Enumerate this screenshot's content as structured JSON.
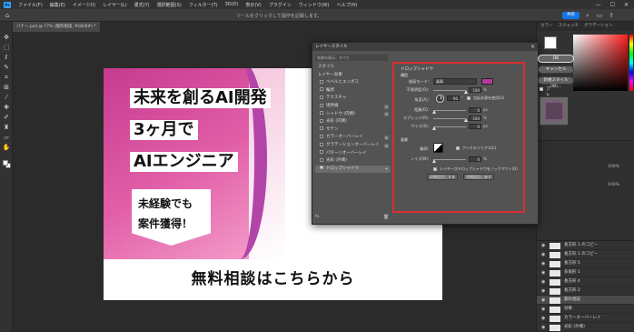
{
  "menubar": {
    "logo": "Ps",
    "items": [
      "ファイル(F)",
      "編集(E)",
      "イメージ(I)",
      "レイヤー(L)",
      "書式(Y)",
      "選択範囲(S)",
      "フィルター(T)",
      "3D(D)",
      "表示(V)",
      "プラグイン",
      "ウィンドウ(W)",
      "ヘルプ(H)"
    ],
    "window_controls": [
      "—",
      "☐",
      "✕"
    ]
  },
  "options_bar": {
    "hint": "ツールをクリックして操作を記録します。",
    "share_label": "共有"
  },
  "document_tab": {
    "label": "バナー.psd @ 77% (無料相談, RGB/8#) *"
  },
  "banner": {
    "line1": "未来を創るAI開発",
    "line2": "3ヶ月で",
    "line3": "AIエンジニア",
    "sub1": "未経験でも",
    "sub2": "案件獲得！",
    "cta": "無料相談はこちらから"
  },
  "right_panel": {
    "tabs": [
      "カラー",
      "スウォッチ",
      "グラデーション"
    ],
    "props_labels": [
      "100%",
      "100%"
    ],
    "layers": [
      {
        "name": "長方形 1 のコピー",
        "selected": false
      },
      {
        "name": "長方形 1 のコピー",
        "selected": false
      },
      {
        "name": "長方形 5",
        "selected": false
      },
      {
        "name": "多角形 1",
        "selected": false
      },
      {
        "name": "長方形 4",
        "selected": false
      },
      {
        "name": "長方形 2",
        "selected": false
      },
      {
        "name": "無料相談",
        "selected": true
      },
      {
        "name": "効果",
        "selected": false
      },
      {
        "name": "カラーオーバーレイ",
        "selected": false
      },
      {
        "name": "光彩 (外側)",
        "selected": false
      }
    ]
  },
  "dialog": {
    "title": "レイヤースタイル",
    "search_placeholder": "効果の表示：すべて",
    "styles": [
      {
        "label": "スタイル",
        "checkbox": false,
        "plus": false,
        "selected": false
      },
      {
        "label": "レイヤー効果",
        "checkbox": false,
        "plus": false,
        "selected": false
      },
      {
        "label": "ベベルとエンボス",
        "checkbox": true,
        "plus": false,
        "selected": false
      },
      {
        "label": "輪郭",
        "checkbox": true,
        "plus": false,
        "selected": false
      },
      {
        "label": "テクスチャ",
        "checkbox": true,
        "plus": false,
        "selected": false
      },
      {
        "label": "境界線",
        "checkbox": true,
        "plus": true,
        "selected": false
      },
      {
        "label": "シャドウ (内側)",
        "checkbox": true,
        "plus": true,
        "selected": false
      },
      {
        "label": "光彩 (内側)",
        "checkbox": true,
        "plus": false,
        "selected": false
      },
      {
        "label": "サテン",
        "checkbox": true,
        "plus": false,
        "selected": false
      },
      {
        "label": "カラーオーバーレイ",
        "checkbox": true,
        "plus": true,
        "selected": false
      },
      {
        "label": "グラデーションオーバーレイ",
        "checkbox": true,
        "plus": true,
        "selected": false
      },
      {
        "label": "パターンオーバーレイ",
        "checkbox": true,
        "plus": false,
        "selected": false
      },
      {
        "label": "光彩 (外側)",
        "checkbox": true,
        "plus": false,
        "selected": false
      },
      {
        "label": "ドロップシャドウ",
        "checkbox": true,
        "plus": true,
        "selected": true
      }
    ],
    "fx_label": "fx.",
    "section_title": "ドロップシャドウ",
    "structure_label": "構造",
    "blend_mode_label": "描画モード：",
    "blend_mode_value": "乗算",
    "shadow_color": "#b8399a",
    "opacity_label": "不透明度(O)：",
    "opacity_value": "100",
    "angle_label": "角度(A)：",
    "angle_value": "90",
    "global_light_label": "包括光源を使用(G)",
    "distance_label": "距離(D)：",
    "distance_value": "0",
    "spread_label": "スプレッド(R)：",
    "spread_value": "100",
    "size_label": "サイズ(S)：",
    "size_value": "0",
    "quality_label": "画質",
    "contour_label": "輪郭：",
    "antialias_label": "アンチエイリアス(L)",
    "noise_label": "ノイズ(N)：",
    "noise_value": "0",
    "knockout_label": "レイヤーがドロップシャドウをノックアウト(U)",
    "make_default": "初期設定にする",
    "reset_default": "初期設定に戻す",
    "unit_percent": "%",
    "unit_px": "px",
    "unit_deg": "°",
    "ok": "OK",
    "cancel": "キャンセル",
    "new_style": "新規スタイル(W)...",
    "preview_label": "プレビュー(V)"
  }
}
